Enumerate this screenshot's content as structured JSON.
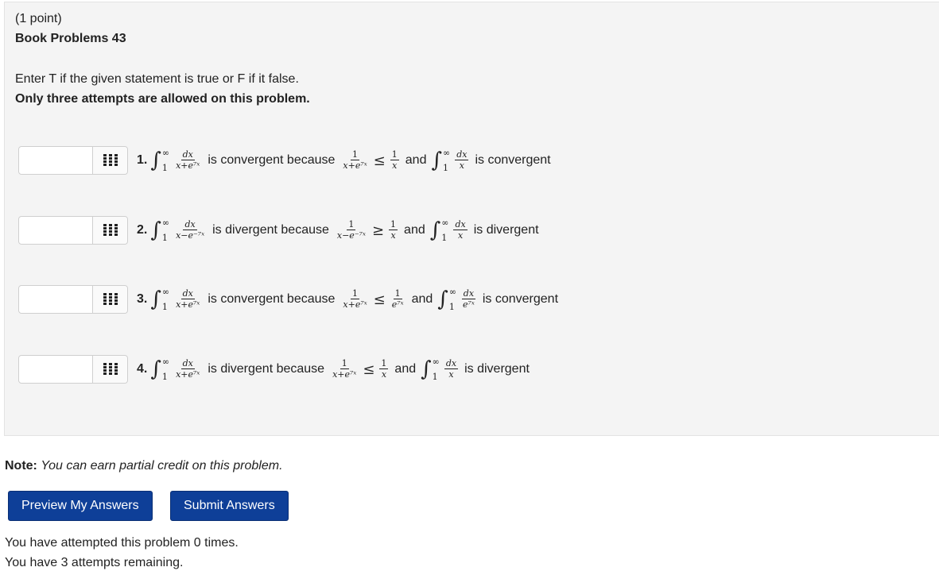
{
  "problem": {
    "points": "(1 point)",
    "title": "Book Problems 43",
    "instruction": "Enter T if the given statement is true or F if it false.",
    "attempts_warning": "Only three attempts are allowed on this problem."
  },
  "statements": [
    {
      "number": "1.",
      "lhs_den": "x+e⁷ˣ",
      "reason_text": "is convergent because",
      "cmp_den": "x+e⁷ˣ",
      "relation": "≤",
      "rhs_den": "x",
      "and_text": "and",
      "int2_den": "x",
      "conclusion": "is convergent"
    },
    {
      "number": "2.",
      "lhs_den": "x−e⁻⁷ˣ",
      "reason_text": "is divergent because",
      "cmp_den": "x−e⁻⁷ˣ",
      "relation": "≥",
      "rhs_den": "x",
      "and_text": "and",
      "int2_den": "x",
      "conclusion": "is divergent"
    },
    {
      "number": "3.",
      "lhs_den": "x+e⁷ˣ",
      "reason_text": "is convergent because",
      "cmp_den": "x+e⁷ˣ",
      "relation": "≤",
      "rhs_den": "e⁷ˣ",
      "and_text": "and",
      "int2_den": "e⁷ˣ",
      "conclusion": "is convergent"
    },
    {
      "number": "4.",
      "lhs_den": "x+e⁷ˣ",
      "reason_text": "is divergent because",
      "cmp_den": "x+e⁷ˣ",
      "relation": "≤",
      "rhs_den": "x",
      "and_text": "and",
      "int2_den": "x",
      "conclusion": "is divergent"
    }
  ],
  "math": {
    "integral": "∫",
    "upper": "∞",
    "lower": "1",
    "dx": "dx",
    "one": "1"
  },
  "note": {
    "label": "Note:",
    "text": "You can earn partial credit on this problem."
  },
  "buttons": {
    "preview": "Preview My Answers",
    "submit": "Submit Answers"
  },
  "status": {
    "attempted": "You have attempted this problem 0 times.",
    "remaining": "You have 3 attempts remaining."
  },
  "colors": {
    "button_bg": "#0e3f98",
    "panel_bg": "#f4f4f4"
  },
  "icons": {
    "answer_grid": "grid-icon"
  }
}
